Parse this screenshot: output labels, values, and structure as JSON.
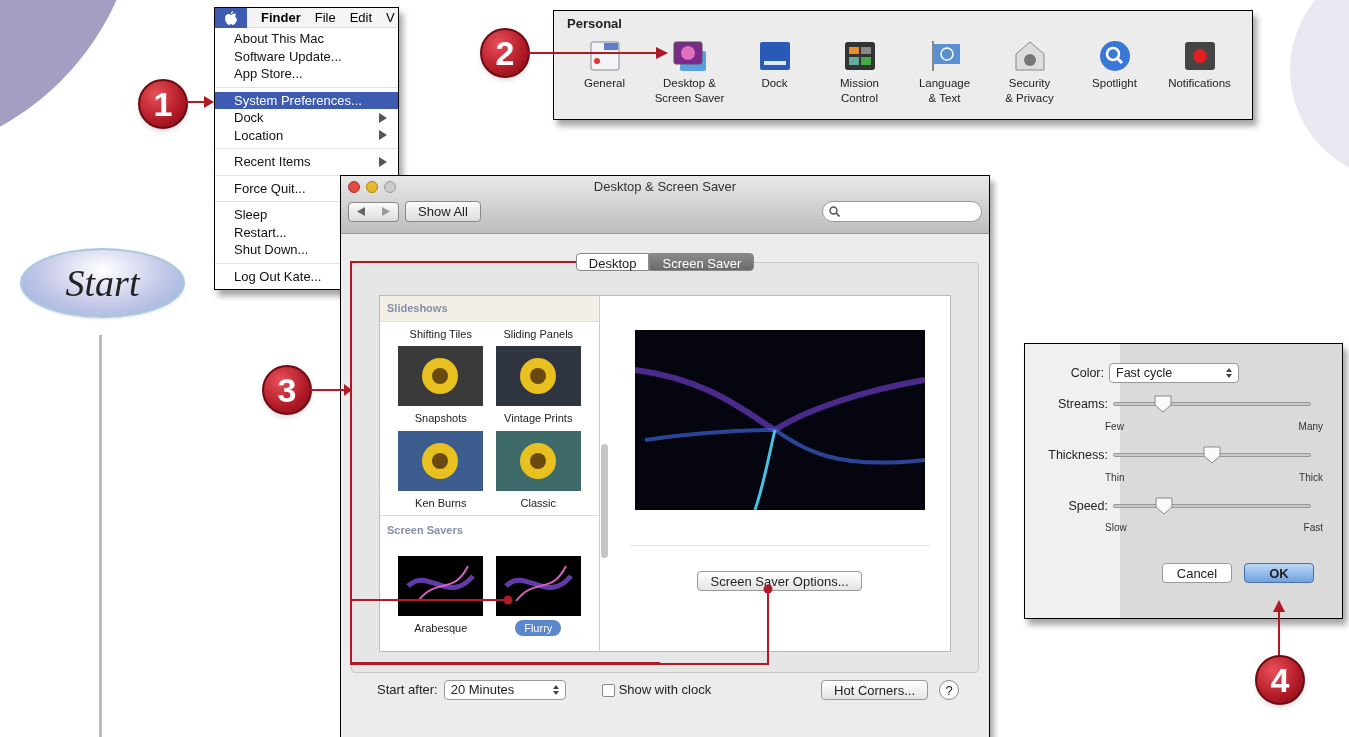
{
  "start": {
    "label": "Start"
  },
  "badges": [
    "1",
    "2",
    "3",
    "4"
  ],
  "menu": {
    "menubar": [
      {
        "label": "Finder",
        "bold": true
      },
      {
        "label": "File",
        "bold": false
      },
      {
        "label": "Edit",
        "bold": false
      },
      {
        "label": "V",
        "bold": false
      }
    ],
    "groups": [
      [
        {
          "label": "About This Mac",
          "selected": false,
          "submenu": false
        },
        {
          "label": "Software Update...",
          "selected": false,
          "submenu": false
        },
        {
          "label": "App Store...",
          "selected": false,
          "submenu": false
        }
      ],
      [
        {
          "label": "System Preferences...",
          "selected": true,
          "submenu": false
        },
        {
          "label": "Dock",
          "selected": false,
          "submenu": true
        },
        {
          "label": "Location",
          "selected": false,
          "submenu": true
        }
      ],
      [
        {
          "label": "Recent Items",
          "selected": false,
          "submenu": true
        }
      ],
      [
        {
          "label": "Force Quit...",
          "selected": false,
          "submenu": false
        }
      ],
      [
        {
          "label": "Sleep",
          "selected": false,
          "submenu": false
        },
        {
          "label": "Restart...",
          "selected": false,
          "submenu": false
        },
        {
          "label": "Shut Down...",
          "selected": false,
          "submenu": false
        }
      ],
      [
        {
          "label": "Log Out Kate...",
          "selected": false,
          "submenu": false
        }
      ]
    ]
  },
  "preferences": {
    "section": "Personal",
    "items": [
      {
        "lines": [
          "General"
        ]
      },
      {
        "lines": [
          "Desktop &",
          "Screen Saver"
        ]
      },
      {
        "lines": [
          "Dock"
        ]
      },
      {
        "lines": [
          "Mission",
          "Control"
        ]
      },
      {
        "lines": [
          "Language",
          "& Text"
        ]
      },
      {
        "lines": [
          "Security",
          "& Privacy"
        ]
      },
      {
        "lines": [
          "Spotlight"
        ]
      },
      {
        "lines": [
          "Notifications"
        ]
      }
    ]
  },
  "window": {
    "title": "Desktop & Screen Saver",
    "show_all": "Show All",
    "tabs": [
      {
        "label": "Desktop",
        "selected": false
      },
      {
        "label": "Screen Saver",
        "selected": true
      }
    ],
    "sections": [
      {
        "heading": "Slideshows",
        "items": [
          {
            "label": "Shifting Tiles",
            "selected": false,
            "thumbnail": false
          },
          {
            "label": "Sliding Panels",
            "selected": false,
            "thumbnail": false
          },
          {
            "label": "Snapshots",
            "selected": false,
            "thumbnail": true
          },
          {
            "label": "Vintage Prints",
            "selected": false,
            "thumbnail": true
          },
          {
            "label": "Ken Burns",
            "selected": false,
            "thumbnail": true
          },
          {
            "label": "Classic",
            "selected": false,
            "thumbnail": true
          }
        ]
      },
      {
        "heading": "Screen Savers",
        "items": [
          {
            "label": "Arabesque",
            "selected": false,
            "thumbnail": true
          },
          {
            "label": "Flurry",
            "selected": true,
            "thumbnail": true
          }
        ]
      }
    ],
    "options_button": "Screen Saver Options...",
    "start_after": {
      "label": "Start after:",
      "value": "20 Minutes"
    },
    "show_clock": {
      "label": "Show with clock",
      "checked": false
    },
    "hot_corners": "Hot Corners...",
    "help": "?"
  },
  "options_dialog": {
    "color": {
      "label": "Color:",
      "value": "Fast cycle"
    },
    "sliders": [
      {
        "label": "Streams:",
        "level": 0.25,
        "min_label": "Few",
        "max_label": "Many"
      },
      {
        "label": "Thickness:",
        "level": 0.5,
        "min_label": "Thin",
        "max_label": "Thick"
      },
      {
        "label": "Speed:",
        "level": 0.26,
        "min_label": "Slow",
        "max_label": "Fast"
      }
    ],
    "buttons": [
      {
        "label": "Cancel",
        "default": false
      },
      {
        "label": "OK",
        "default": true
      }
    ]
  }
}
